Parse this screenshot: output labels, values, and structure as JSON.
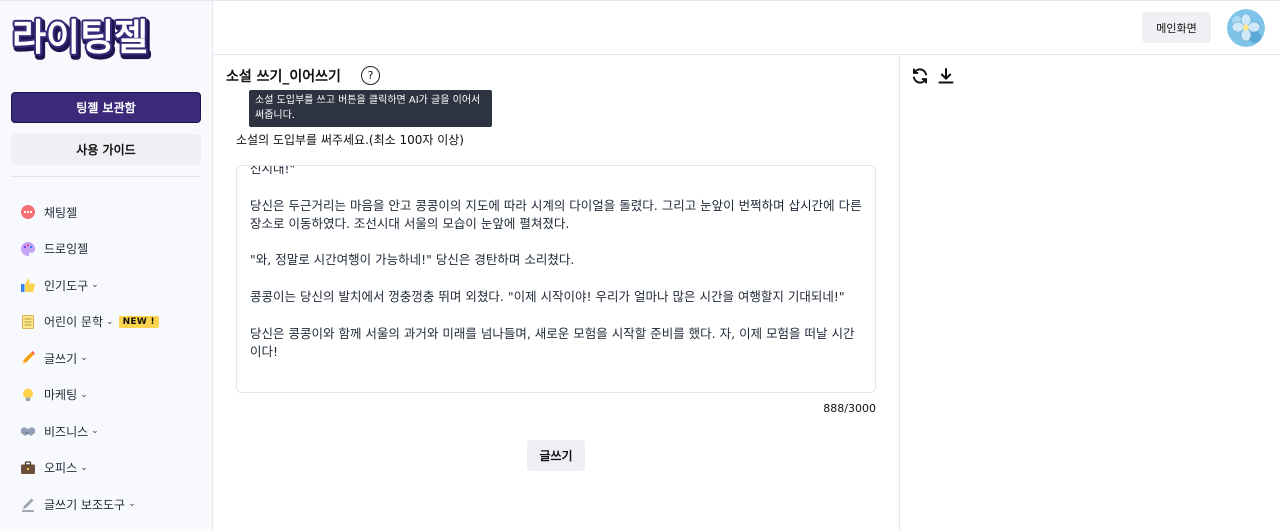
{
  "app": {
    "logo_text": "라이팅젤"
  },
  "sidebar": {
    "archive_button": "팅젤 보관함",
    "guide_button": "사용 가이드",
    "items": [
      {
        "label": "채팅젤",
        "icon": "chat-bubble-icon",
        "chevron": false
      },
      {
        "label": "드로잉젤",
        "icon": "palette-icon",
        "chevron": false
      },
      {
        "label": "인기도구",
        "icon": "thumbs-up-icon",
        "chevron": true
      },
      {
        "label": "어린이 문학",
        "icon": "notepad-icon",
        "chevron": true,
        "badge": "NEW !"
      },
      {
        "label": "글쓰기",
        "icon": "pencil-icon",
        "chevron": true
      },
      {
        "label": "마케팅",
        "icon": "lightbulb-icon",
        "chevron": true
      },
      {
        "label": "비즈니스",
        "icon": "handshake-icon",
        "chevron": true
      },
      {
        "label": "오피스",
        "icon": "briefcase-icon",
        "chevron": true
      },
      {
        "label": "글쓰기 보조도구",
        "icon": "pen-icon",
        "chevron": true
      }
    ],
    "chevron_glyph": "⌄"
  },
  "header": {
    "main_button": "메인화면"
  },
  "main": {
    "title": "소설 쓰기_이어쓰기",
    "help_glyph": "?",
    "tooltip": "소설 도입부를 쓰고 버튼을 클릭하면 AI가 글을 이어서 써줍니다.",
    "prompt": "소설의 도입부를 써주세요.(최소 100자 이상)",
    "textarea_value": "선시대!\"\n\n당신은 두근거리는 마음을 안고 콩콩이의 지도에 따라 시계의 다이얼을 돌렸다. 그리고 눈앞이 번쩍하며 삽시간에 다른 장소로 이동하였다. 조선시대 서울의 모습이 눈앞에 펼쳐졌다.\n\n\"와, 정말로 시간여행이 가능하네!\" 당신은 경탄하며 소리쳤다.\n\n콩콩이는 당신의 발치에서 껑충껑충 뛰며 외쳤다. \"이제 시작이야! 우리가 얼마나 많은 시간을 여행할지 기대되네!\"\n\n당신은 콩콩이와 함께 서울의 과거와 미래를 넘나들며, 새로운 모험을 시작할 준비를 했다. 자, 이제 모험을 떠날 시간이다!",
    "char_count": "888/3000",
    "write_button": "글쓰기"
  },
  "right_panel": {
    "tools": [
      "refresh-icon",
      "download-icon"
    ]
  },
  "colors": {
    "brand_purple": "#3b2a7a",
    "button_gray": "#eef0f4",
    "tooltip_bg": "#2d3340",
    "badge_yellow": "#fcd34d"
  }
}
